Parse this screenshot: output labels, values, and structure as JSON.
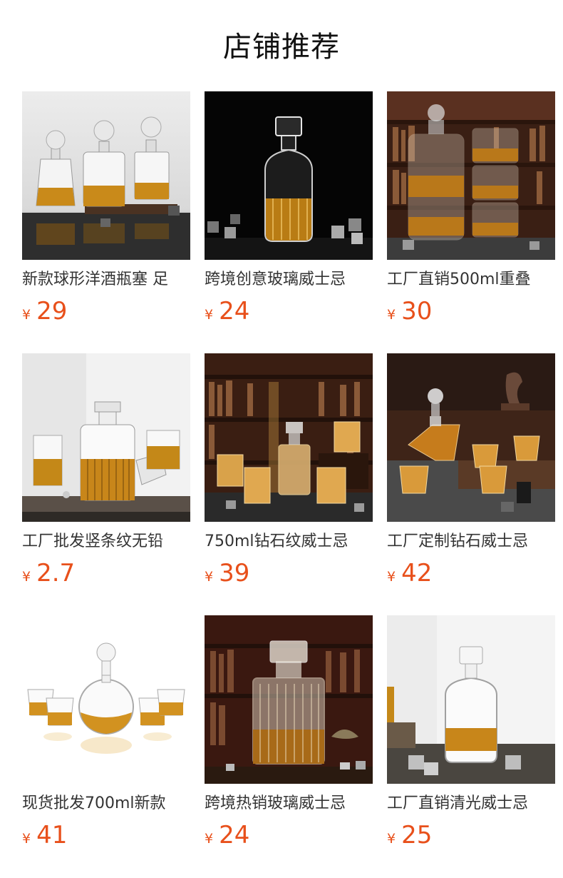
{
  "page": {
    "title": "店铺推荐"
  },
  "colors": {
    "price": "#e8501b",
    "text": "#333333",
    "title": "#111111"
  },
  "products": [
    {
      "name": "新款球形洋酒瓶塞 足",
      "currency": "¥",
      "price": "29",
      "image_icon": "whisky-decanter-set-icon",
      "scene": "light"
    },
    {
      "name": "跨境创意玻璃威士忌",
      "currency": "¥",
      "price": "24",
      "image_icon": "whisky-decanter-icon",
      "scene": "dark"
    },
    {
      "name": "工厂直销500ml重叠",
      "currency": "¥",
      "price": "30",
      "image_icon": "stacked-decanter-icon",
      "scene": "library"
    },
    {
      "name": "工厂批发竖条纹无铅",
      "currency": "¥",
      "price": "2.7",
      "image_icon": "striped-decanter-icon",
      "scene": "light"
    },
    {
      "name": "750ml钻石纹威士忌",
      "currency": "¥",
      "price": "39",
      "image_icon": "diamond-pattern-decanter-icon",
      "scene": "library"
    },
    {
      "name": "工厂定制钻石威士忌",
      "currency": "¥",
      "price": "42",
      "image_icon": "diamond-decanter-icon",
      "scene": "library"
    },
    {
      "name": "现货批发700ml新款",
      "currency": "¥",
      "price": "41",
      "image_icon": "round-decanter-icon",
      "scene": "white"
    },
    {
      "name": "跨境热销玻璃威士忌",
      "currency": "¥",
      "price": "24",
      "image_icon": "square-decanter-icon",
      "scene": "library"
    },
    {
      "name": "工厂直销清光威士忌",
      "currency": "¥",
      "price": "25",
      "image_icon": "clear-decanter-icon",
      "scene": "light"
    }
  ]
}
